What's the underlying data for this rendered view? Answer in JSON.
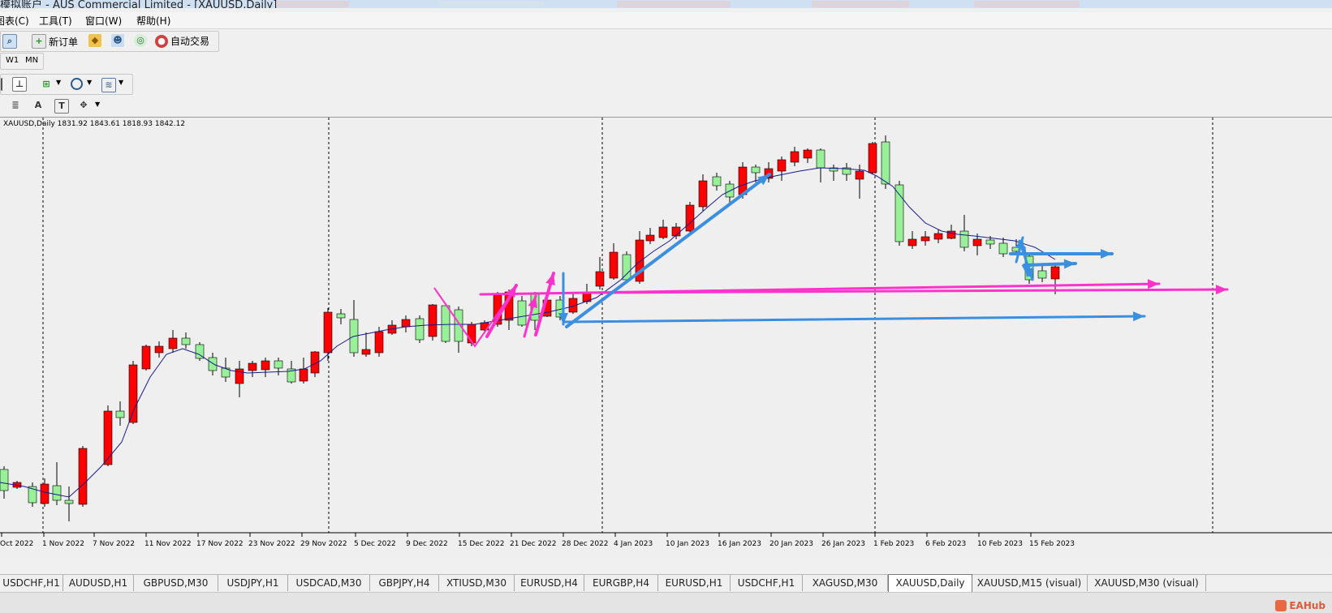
{
  "window": {
    "title": "模拟账户 - AUS Commercial Limited - [XAUUSD,Daily]"
  },
  "menu": [
    "图表(C)",
    "工具(T)",
    "窗口(W)",
    "帮助(H)"
  ],
  "toolbar_main": {
    "new_order_label": "新订单",
    "auto_trade_label": "自动交易"
  },
  "timeframes": [
    "W1",
    "MN"
  ],
  "chart": {
    "header": "XAUUSD,Daily  1831.92 1843.61 1818.93 1842.12",
    "x_labels": [
      "Oct 2022",
      "1 Nov 2022",
      "7 Nov 2022",
      "11 Nov 2022",
      "17 Nov 2022",
      "23 Nov 2022",
      "29 Nov 2022",
      "5 Dec 2022",
      "9 Dec 2022",
      "15 Dec 2022",
      "21 Dec 2022",
      "28 Dec 2022",
      "4 Jan 2023",
      "10 Jan 2023",
      "16 Jan 2023",
      "20 Jan 2023",
      "26 Jan 2023",
      "1 Feb 2023",
      "6 Feb 2023",
      "10 Feb 2023",
      "15 Feb 2023"
    ],
    "colors": {
      "up": "#98f098",
      "down": "#ff0000",
      "ma": "#1a1a8c",
      "magenta": "#ff33cc",
      "blue": "#3b8fe0",
      "bg": "#efefef"
    }
  },
  "tabs": [
    "USDCHF,H1",
    "AUDUSD,H1",
    "GBPUSD,M30",
    "USDJPY,H1",
    "USDCAD,M30",
    "GBPJPY,H4",
    "XTIUSD,M30",
    "EURUSD,H4",
    "EURGBP,H4",
    "EURUSD,H1",
    "USDCHF,H1",
    "XAGUSD,M30",
    "XAUUSD,Daily",
    "XAUUSD,M15 (visual)",
    "XAUUSD,M30 (visual)"
  ],
  "active_tab": "XAUUSD,Daily",
  "watermark": "EAHub"
}
